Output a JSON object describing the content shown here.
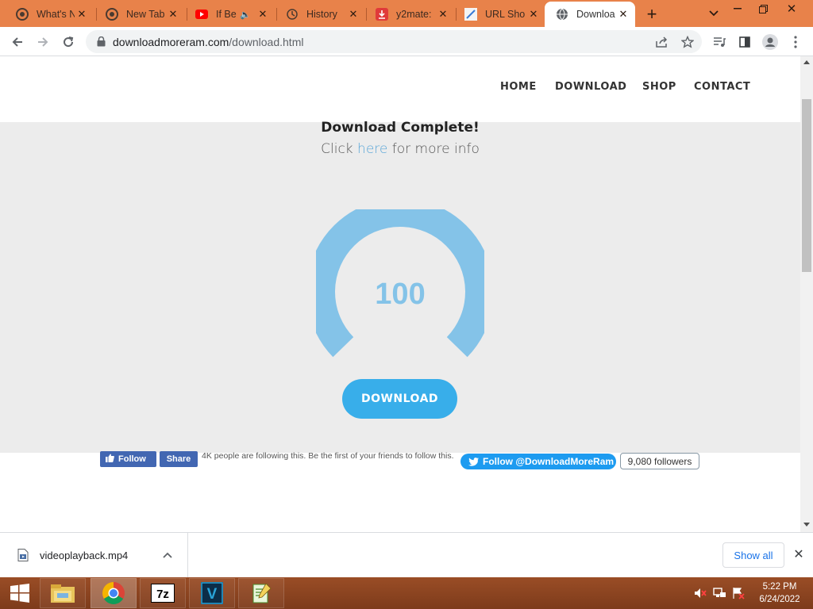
{
  "browser": {
    "tabs": [
      {
        "title": "What's N",
        "icon": "chrome-icon",
        "active": false
      },
      {
        "title": "New Tab",
        "icon": "chrome-icon",
        "active": false
      },
      {
        "title": "If Be",
        "icon": "youtube-icon",
        "active": false,
        "audio": true
      },
      {
        "title": "History",
        "icon": "history-icon",
        "active": false
      },
      {
        "title": "y2mate:",
        "icon": "download-icon",
        "active": false
      },
      {
        "title": "URL Sho",
        "icon": "link-icon",
        "active": false
      },
      {
        "title": "Downloa",
        "icon": "globe-icon",
        "active": true
      }
    ],
    "url_host": "downloadmoreram.com",
    "url_path": "/download.html"
  },
  "site": {
    "nav": [
      "HOME",
      "DOWNLOAD",
      "SHOP",
      "CONTACT"
    ],
    "headline": "Download Complete!",
    "info_pre": "Click ",
    "info_link": "here",
    "info_post": " for more info",
    "gauge_value": "100",
    "download_button": "DOWNLOAD",
    "fb_follow": "Follow",
    "fb_share": "Share",
    "fb_text": "4K people are following this. Be the first of your friends to follow this.",
    "twitter_follow": "Follow @DownloadMoreRam",
    "twitter_count": "9,080 followers"
  },
  "shelf": {
    "filename": "videoplayback.mp4",
    "show_all": "Show all"
  },
  "taskbar": {
    "time": "5:22 PM",
    "date": "6/24/2022",
    "apps": [
      "file-explorer-icon",
      "chrome-icon",
      "7zip-icon",
      "vegas-icon",
      "notepad-icon"
    ]
  },
  "colors": {
    "tabstrip": "#e8824a",
    "gauge": "#84c3e8",
    "download_button": "#38aeea",
    "link": "#5aa6d8"
  }
}
